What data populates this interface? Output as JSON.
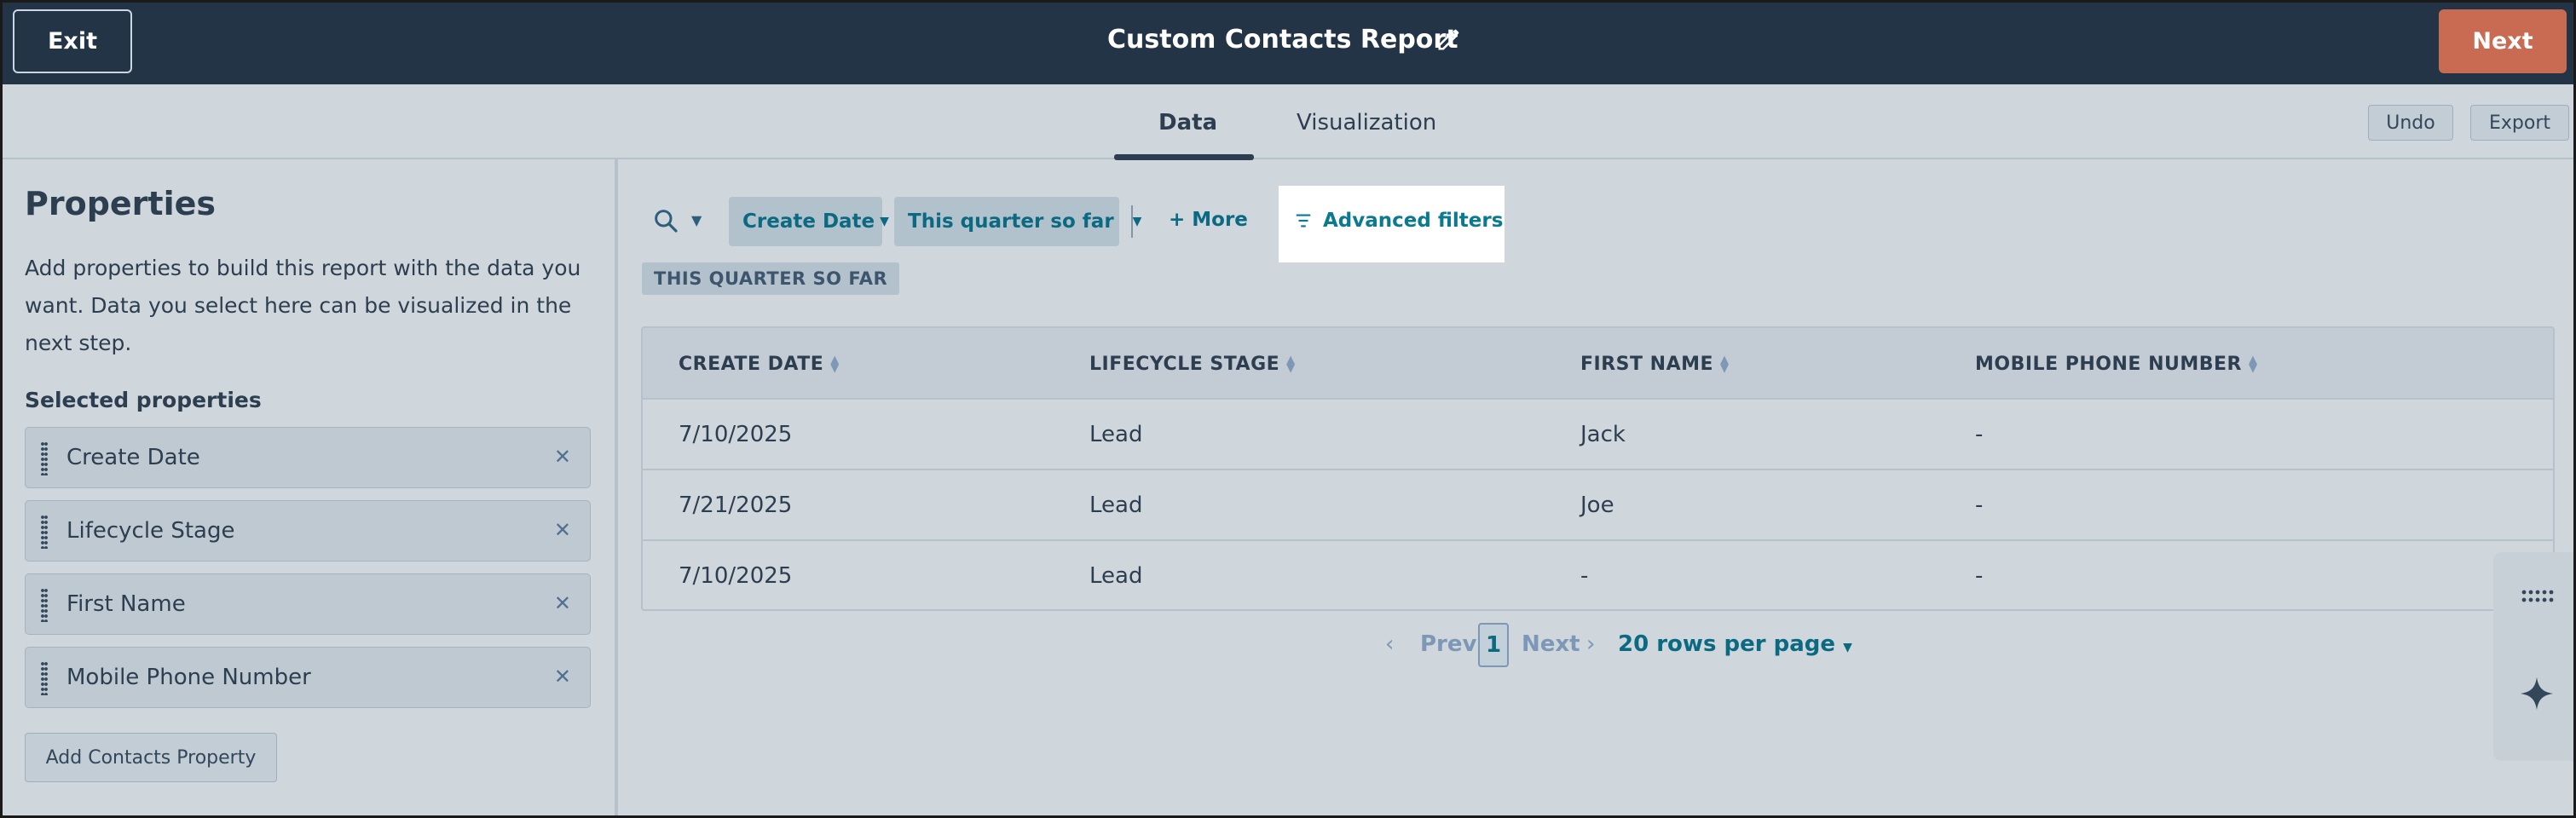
{
  "header": {
    "exit_label": "Exit",
    "report_title": "Custom Contacts Report",
    "next_label": "Next",
    "edit_icon": "pencil-icon"
  },
  "tabs": [
    {
      "label": "Data",
      "active": true
    },
    {
      "label": "Visualization",
      "active": false
    }
  ],
  "toolbar": {
    "undo_label": "Undo",
    "export_label": "Export"
  },
  "properties_panel": {
    "title": "Properties",
    "description": "Add properties to build this report with the data you want. Data you select here can be visualized in the next step.",
    "selected_label": "Selected properties",
    "items": [
      {
        "label": "Create Date"
      },
      {
        "label": "Lifecycle Stage"
      },
      {
        "label": "First Name"
      },
      {
        "label": "Mobile Phone Number"
      }
    ],
    "add_button_label": "Add Contacts Property"
  },
  "filters": {
    "create_date_label": "Create Date",
    "quarter_label": "This quarter so far",
    "more_label": "+ More",
    "advanced_label": "Advanced filters",
    "active_tag": "THIS QUARTER SO FAR"
  },
  "table": {
    "headers": [
      "CREATE DATE",
      "LIFECYCLE STAGE",
      "FIRST NAME",
      "MOBILE PHONE NUMBER"
    ],
    "rows": [
      [
        "7/10/2025",
        "Lead",
        "Jack",
        "-"
      ],
      [
        "7/21/2025",
        "Lead",
        "Joe",
        "-"
      ],
      [
        "7/10/2025",
        "Lead",
        "-",
        "-"
      ]
    ]
  },
  "pagination": {
    "prev_label": "Prev",
    "current_page": "1",
    "next_label": "Next",
    "rows_per_page": "20 rows per page"
  },
  "colors": {
    "header_bg": "#233446",
    "next_button": "#c96a53",
    "link": "#0b6a82",
    "highlight": "#ffffff"
  }
}
